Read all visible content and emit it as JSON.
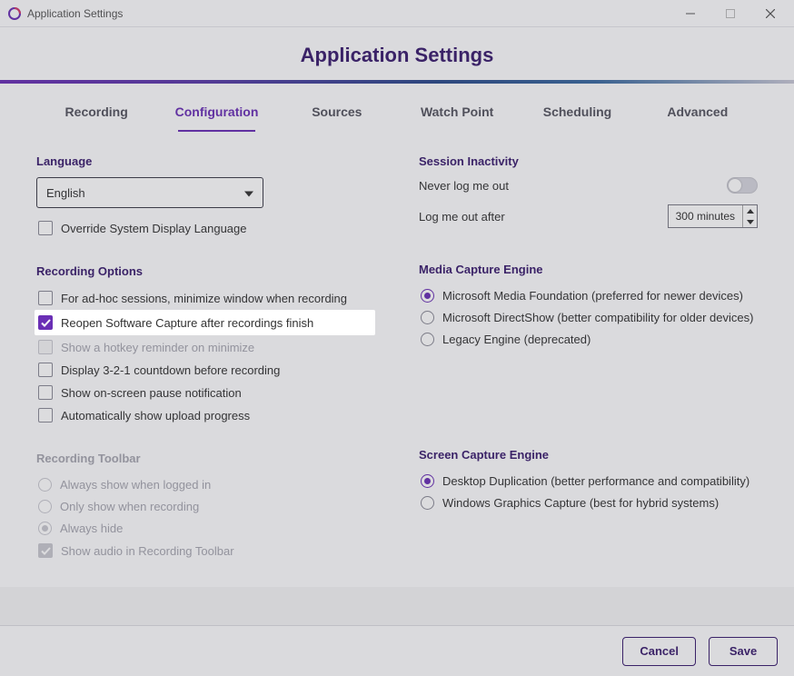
{
  "titlebar": {
    "title": "Application Settings"
  },
  "header": {
    "title": "Application Settings"
  },
  "tabs": {
    "recording": "Recording",
    "configuration": "Configuration",
    "sources": "Sources",
    "watchPoint": "Watch Point",
    "scheduling": "Scheduling",
    "advanced": "Advanced"
  },
  "language": {
    "title": "Language",
    "value": "English",
    "override": "Override System Display Language"
  },
  "recordingOptions": {
    "title": "Recording Options",
    "minimize": "For ad-hoc sessions, minimize window when recording",
    "reopen": "Reopen Software Capture after recordings finish",
    "hotkeyReminder": "Show a hotkey reminder on minimize",
    "countdown": "Display 3-2-1 countdown before recording",
    "pauseNotif": "Show on-screen pause notification",
    "uploadProgress": "Automatically show upload progress"
  },
  "recordingToolbar": {
    "title": "Recording Toolbar",
    "alwaysLogged": "Always show when logged in",
    "onlyRecording": "Only show when recording",
    "alwaysHide": "Always hide",
    "showAudio": "Show audio in Recording Toolbar"
  },
  "sessionInactivity": {
    "title": "Session Inactivity",
    "neverLogout": "Never log me out",
    "logoutAfter": "Log me out after",
    "value": "300 minutes"
  },
  "mediaEngine": {
    "title": "Media Capture Engine",
    "mmf": "Microsoft Media Foundation (preferred for newer devices)",
    "directshow": "Microsoft DirectShow (better compatibility for older devices)",
    "legacy": "Legacy Engine (deprecated)"
  },
  "screenEngine": {
    "title": "Screen Capture Engine",
    "dd": "Desktop Duplication (better performance and compatibility)",
    "wgc": "Windows Graphics Capture (best for hybrid systems)"
  },
  "footer": {
    "cancel": "Cancel",
    "save": "Save"
  }
}
